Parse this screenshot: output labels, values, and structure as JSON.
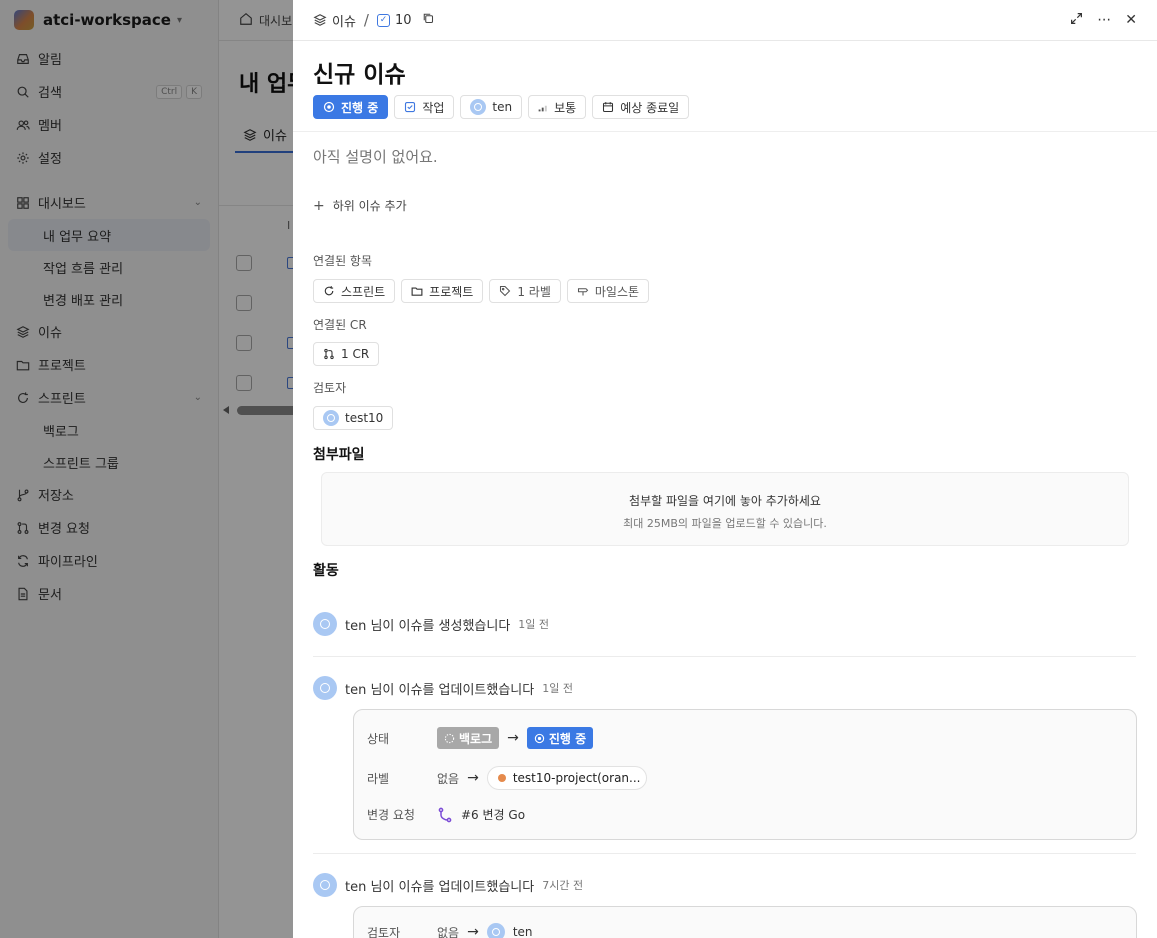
{
  "sidebar": {
    "workspace": "atci-workspace",
    "top": [
      {
        "label": "알림",
        "icon": "inbox-icon"
      },
      {
        "label": "검색",
        "icon": "search-icon",
        "kbd": [
          "Ctrl",
          "K"
        ]
      },
      {
        "label": "멤버",
        "icon": "members-icon"
      },
      {
        "label": "설정",
        "icon": "gear-icon"
      }
    ],
    "dashboard": "대시보드",
    "dashboard_items": [
      "내 업무 요약",
      "작업 흐름 관리",
      "변경 배포 관리"
    ],
    "issues": "이슈",
    "projects": "프로젝트",
    "sprints": "스프린트",
    "sprint_items": [
      "백로그",
      "스프린트 그룹"
    ],
    "bottom": [
      "저장소",
      "변경 요청",
      "파이프라인",
      "문서"
    ]
  },
  "main": {
    "breadcrumb": "대시보",
    "title": "내 업무",
    "tab": "이슈",
    "col_header": "I"
  },
  "panel": {
    "breadcrumb_issue": "이슈",
    "breadcrumb_sep": "/",
    "issue_number": "10",
    "title": "신규 이슈",
    "chips": {
      "status": "진행 중",
      "type": "작업",
      "assignee": "ten",
      "priority": "보통",
      "due": "예상 종료일"
    },
    "description_placeholder": "아직 설명이 없어요.",
    "add_sub_issue": "하위 이슈 추가",
    "linked_items_label": "연결된 항목",
    "linked_items": {
      "sprint": "스프린트",
      "project": "프로젝트",
      "label": "1 라벨",
      "milestone": "마일스톤"
    },
    "linked_cr_label": "연결된 CR",
    "linked_cr": "1 CR",
    "reviewer_label": "검토자",
    "reviewer": "test10",
    "attachments_title": "첨부파일",
    "dropzone_main": "첨부할 파일을 여기에 놓아 추가하세요",
    "dropzone_sub": "최대 25MB의 파일을 업로드할 수 있습니다.",
    "activity_title": "활동",
    "activities": [
      {
        "text": "ten 님이 이슈를 생성했습니다",
        "time": "1일 전"
      },
      {
        "text": "ten 님이 이슈를 업데이트했습니다",
        "time": "1일 전"
      },
      {
        "text": "ten 님이 이슈를 업데이트했습니다",
        "time": "7시간 전"
      }
    ],
    "change1": {
      "status_key": "상태",
      "status_from": "백로그",
      "status_to": "진행 중",
      "label_key": "라벨",
      "label_from": "없음",
      "label_to": "test10-project(oran...",
      "cr_key": "변경 요청",
      "cr_value": "#6 변경 Go"
    },
    "change2": {
      "reviewer_key": "검토자",
      "reviewer_from": "없음",
      "reviewer_to": "ten"
    },
    "arrow": "→"
  },
  "colors": {
    "accent": "#3b79e4",
    "backlog_gray": "#a8a8a8",
    "label_orange": "#e58a4c",
    "overlay": "rgba(0,0,0,0.42)"
  }
}
